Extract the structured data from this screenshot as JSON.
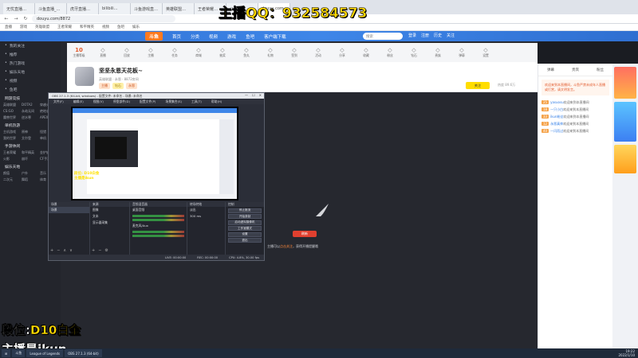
{
  "browser": {
    "tabs": [
      "无忧直播…",
      "斗鱼直播_…",
      "虎牙直播…",
      "bilibili…",
      "斗鱼游戏直…",
      "英雄联盟…",
      "王者荣耀…",
      "斗鱼…",
      "douyu.com"
    ],
    "url": "douyu.com/8872",
    "bookmarks": [
      "直播",
      "游戏",
      "英雄联盟",
      "王者荣耀",
      "和平精英",
      "视频",
      "鱼吧",
      "娱乐"
    ]
  },
  "site": {
    "logo": "斗鱼",
    "nav": [
      "首页",
      "分类",
      "视频",
      "游戏",
      "鱼吧",
      "客户端下载"
    ],
    "search_placeholder": "搜索",
    "header_icons": [
      "登录",
      "注册",
      "历史",
      "关注"
    ]
  },
  "sidebar": {
    "items": [
      "我的关注",
      "推荐",
      "热门游戏",
      "娱乐天地",
      "视频",
      "鱼吧"
    ],
    "sections": [
      {
        "title": "网游竞技",
        "cells": [
          "英雄联盟",
          "DOTA2",
          "穿越火线",
          "CS:GO",
          "永劫无间",
          "绝地求生",
          "魔兽世界",
          "逆水寒",
          "APEX"
        ]
      },
      {
        "title": "单机热游",
        "cells": [
          "主机游戏",
          "原神",
          "怪猎",
          "我的世界",
          "艾尔登",
          "单机"
        ]
      },
      {
        "title": "手游休闲",
        "cells": [
          "王者荣耀",
          "和平精英",
          "金铲铲",
          "火影",
          "崩坏",
          "CF手游"
        ]
      },
      {
        "title": "娱乐天地",
        "cells": [
          "颜值",
          "户外",
          "音乐",
          "二次元",
          "舞蹈",
          "体育"
        ]
      }
    ]
  },
  "toolbar": {
    "items": [
      "10",
      "直播",
      "回放",
      "主播",
      "任务",
      "商城",
      "抽奖",
      "鱼丸",
      "礼物",
      "签到",
      "活动",
      "分享",
      "收藏",
      "粉丝",
      "钻石",
      "贵族",
      "弹幕",
      "设置"
    ],
    "first_label": "主播等级"
  },
  "room": {
    "title": "坚坚永恩天花板~",
    "meta": "英雄联盟 · 永恩 · 8872房间",
    "tags": [
      "主播",
      "钻石",
      "永恩"
    ],
    "follow": "关注",
    "stats": "热度 89.6万"
  },
  "player": {
    "hint_button": "刷新",
    "hint_pre": "主播可以",
    "hint_highlight": "点击关注",
    "hint_post": "，获得开播提醒哦"
  },
  "chat": {
    "tabs": [
      "弹幕",
      "贵宾",
      "粉丝"
    ],
    "notice": "欢迎来到本直播间，斗鱼严禁未成年人直播或打赏，请文明发言。",
    "messages": [
      {
        "lvl": "25",
        "nick": "yasuosu",
        "text": "欢迎来到本直播间"
      },
      {
        "lvl": "18",
        "nick": "一只小白",
        "text": "欢迎来到本直播间"
      },
      {
        "lvl": "33",
        "nick": "ikun粉丝",
        "text": "欢迎来到本直播间"
      },
      {
        "lvl": "12",
        "nick": "永恩真帅",
        "text": "欢迎来到本直播间"
      },
      {
        "lvl": "40",
        "nick": "一闪而过",
        "text": "欢迎来到本直播间"
      }
    ]
  },
  "obs": {
    "title": "OBS 27.1.3 (64-bit, windows) - 配置文件: 未命名 - 场景: 未命名",
    "menu": [
      "文件(F)",
      "编辑(E)",
      "视图(V)",
      "停靠部件(D)",
      "配置文件(P)",
      "场景集合(S)",
      "工具(T)",
      "帮助(H)"
    ],
    "preview_label_1": "段位: D10白金",
    "preview_label_2": "主播是ikun",
    "docks": [
      "场景",
      "来源",
      "音频混音器",
      "转场特效",
      "控制"
    ],
    "scene": "场景",
    "sources": [
      "图像",
      "文本",
      "显示器采集"
    ],
    "mixer": [
      "桌面音频",
      "麦克风/Aux"
    ],
    "transition": "淡出",
    "duration": "300 ms",
    "controls": [
      "停止推流",
      "开始录制",
      "启动虚拟摄像机",
      "工作室模式",
      "设置",
      "退出"
    ],
    "status": [
      "LIVE: 00:00:00",
      "REC: 00:00:00",
      "CPU: 4.8%, 30.00 fps"
    ]
  },
  "overlays": {
    "qq": "主播QQ：932584573",
    "rank_label": "段位:",
    "rank_value": "D10白金",
    "streamer": "主播是ikun"
  },
  "taskbar": {
    "apps": [
      "斗鱼",
      "League of Legends",
      "OBS 27.1.3 (64-bit)"
    ],
    "time": "19:22",
    "date": "2022/1/10"
  }
}
